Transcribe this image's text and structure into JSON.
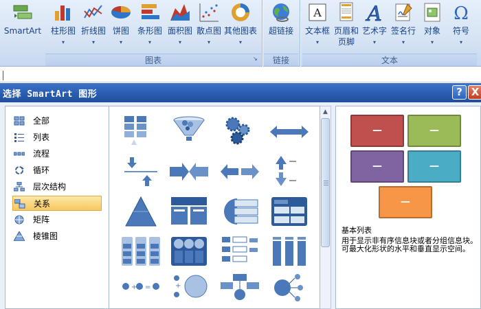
{
  "ribbon": {
    "buttons": [
      {
        "label": "SmartArt",
        "icon": "smartart-icon"
      },
      {
        "label": "柱形图",
        "icon": "column-chart-icon"
      },
      {
        "label": "折线图",
        "icon": "line-chart-icon"
      },
      {
        "label": "饼图",
        "icon": "pie-chart-icon"
      },
      {
        "label": "条形图",
        "icon": "bar-chart-icon"
      },
      {
        "label": "面积图",
        "icon": "area-chart-icon"
      },
      {
        "label": "散点图",
        "icon": "scatter-chart-icon"
      },
      {
        "label": "其他图表",
        "icon": "other-charts-icon"
      },
      {
        "label": "超链接",
        "icon": "hyperlink-icon"
      },
      {
        "label": "文本框",
        "icon": "textbox-icon"
      },
      {
        "label": "页眉和",
        "label2": "页脚",
        "icon": "header-footer-icon"
      },
      {
        "label": "艺术字",
        "icon": "wordart-icon"
      },
      {
        "label": "签名行",
        "icon": "signature-line-icon"
      },
      {
        "label": "对象",
        "icon": "object-icon"
      },
      {
        "label": "符号",
        "icon": "symbol-icon"
      }
    ],
    "groups": {
      "chart": "图表",
      "link": "链接",
      "text": "文本"
    }
  },
  "dialog": {
    "title": "选择 SmartArt 图形",
    "help_label": "?",
    "close_label": "X",
    "categories": [
      {
        "label": "全部",
        "icon": "all-icon"
      },
      {
        "label": "列表",
        "icon": "list-icon"
      },
      {
        "label": "流程",
        "icon": "process-icon"
      },
      {
        "label": "循环",
        "icon": "cycle-icon"
      },
      {
        "label": "层次结构",
        "icon": "hierarchy-icon"
      },
      {
        "label": "关系",
        "icon": "relationship-icon",
        "selected": true
      },
      {
        "label": "矩阵",
        "icon": "matrix-icon"
      },
      {
        "label": "棱锥图",
        "icon": "pyramid-icon"
      }
    ],
    "preview": {
      "box_label": "—",
      "colors": [
        "#c0504d",
        "#9bbb59",
        "#8064a2",
        "#4bacc6",
        "#f79646"
      ],
      "title": "基本列表",
      "description": "用于显示非有序信息块或者分组信息块。可最大化形状的水平和垂直显示空间。"
    }
  }
}
